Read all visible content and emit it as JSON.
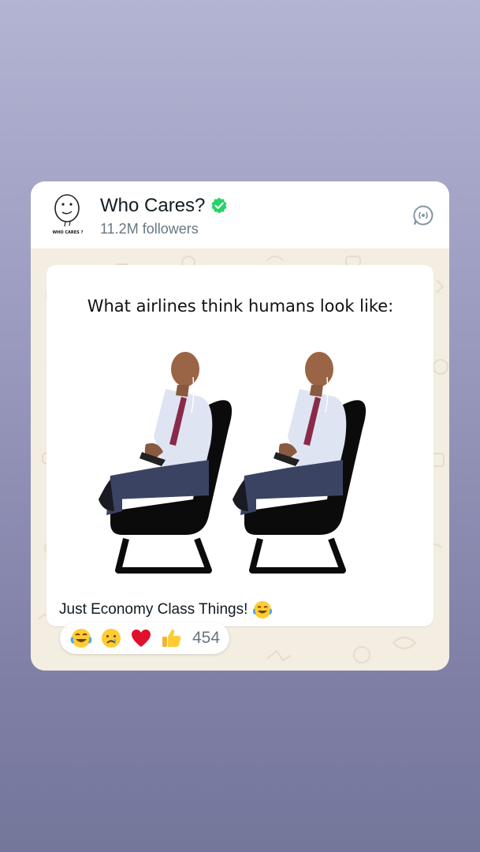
{
  "channel": {
    "name": "Who Cares?",
    "followers": "11.2M followers",
    "avatar_text": "WHO CARES ?"
  },
  "post": {
    "meme_title": "What airlines think humans look like:",
    "caption": "Just Economy Class Things!",
    "caption_emoji": "face-with-tears-of-joy-emoji"
  },
  "reactions": {
    "emojis": [
      "face-with-tears-of-joy-emoji",
      "crying-face-emoji",
      "red-heart-emoji",
      "thumbs-up-emoji"
    ],
    "count": "454"
  },
  "colors": {
    "verified": "#25d366",
    "wallpaper": "#f3ede2",
    "background_top": "#b3b3d3",
    "background_bottom": "#74769a"
  }
}
